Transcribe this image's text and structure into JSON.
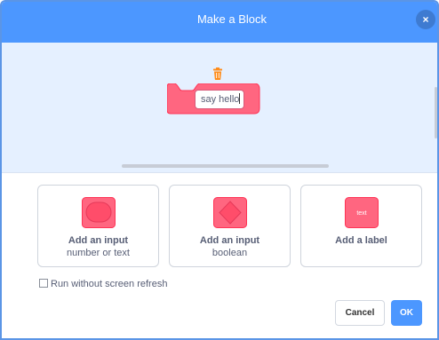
{
  "dialog": {
    "title": "Make a Block",
    "close_label": "×"
  },
  "block": {
    "name_value": "say hello",
    "color": "#ff6680",
    "border_color": "#ff3355"
  },
  "options": [
    {
      "main": "Add an input",
      "sub": "number or text",
      "icon": "number-text-input-icon"
    },
    {
      "main": "Add an input",
      "sub": "boolean",
      "icon": "boolean-input-icon"
    },
    {
      "main": "Add a label",
      "sub": "",
      "icon": "label-icon",
      "icon_text": "text"
    }
  ],
  "run_without_refresh": {
    "label": "Run without screen refresh",
    "checked": false
  },
  "buttons": {
    "cancel": "Cancel",
    "ok": "OK"
  },
  "colors": {
    "accent": "#4c97ff",
    "workspace_bg": "#e5f0ff",
    "block_pink": "#ff6680",
    "trash_orange": "#ff8c1a"
  }
}
